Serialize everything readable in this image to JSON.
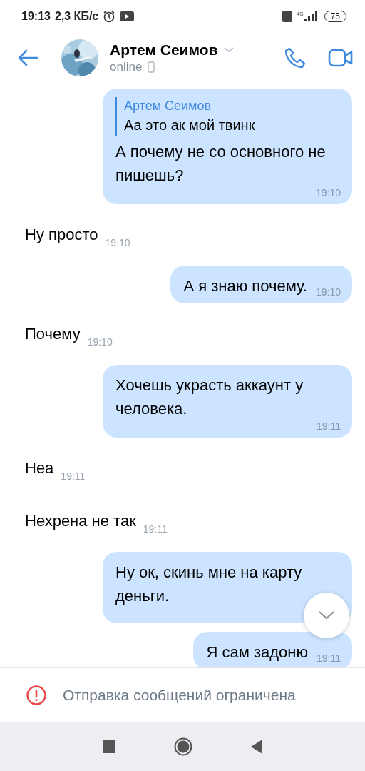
{
  "status_bar": {
    "time": "19:13",
    "speed": "2,3 КБ/с",
    "network": "4G",
    "battery": "75"
  },
  "header": {
    "name": "Артем Сеимов",
    "status": "online"
  },
  "messages": [
    {
      "kind": "out",
      "reply": {
        "author": "Артем Сеимов",
        "text": "Аа это ак мой твинк"
      },
      "text": "А почему не со основного не пишешь?",
      "time": "19:10"
    },
    {
      "kind": "in",
      "text": "Ну просто",
      "time": "19:10"
    },
    {
      "kind": "out",
      "text": "А я знаю почему.",
      "time": "19:10"
    },
    {
      "kind": "in",
      "text": "Почему",
      "time": "19:10"
    },
    {
      "kind": "out",
      "text": "Хочешь украсть аккаунт у человека.",
      "time": "19:11"
    },
    {
      "kind": "in",
      "text": "Неа",
      "time": "19:11"
    },
    {
      "kind": "in",
      "text": "Нехрена не так",
      "time": "19:11"
    },
    {
      "kind": "out",
      "text": "Ну ок, скинь мне на карту деньги."
    },
    {
      "kind": "out",
      "text": "Я сам задоню",
      "time": "19:11"
    }
  ],
  "notice": "Отправка сообщений ограничена"
}
